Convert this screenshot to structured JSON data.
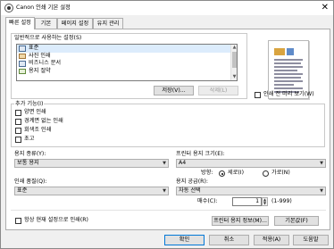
{
  "window": {
    "title": "Canon 인쇄 기본 설정",
    "close_glyph": "✕"
  },
  "tabs": [
    {
      "label": "빠른 설정",
      "active": true
    },
    {
      "label": "기본"
    },
    {
      "label": "페이지 설정"
    },
    {
      "label": "유지 관리"
    }
  ],
  "presets": {
    "label": "일반적으로 사용하는 설정(S)",
    "items": [
      {
        "label": "표준",
        "selected": true
      },
      {
        "label": "사진 인쇄"
      },
      {
        "label": "비즈니스 문서"
      },
      {
        "label": "용지 절약"
      }
    ],
    "save_button": "저장(V)...",
    "delete_button": "삭제(L)"
  },
  "preview": {
    "checkbox_label": "인쇄 전 미리 보기(W)"
  },
  "additional": {
    "label": "추가 기능(I)",
    "options": [
      {
        "label": "양면 인쇄"
      },
      {
        "label": "경계면 없는 인쇄"
      },
      {
        "label": "회색조 인쇄"
      },
      {
        "label": "초고"
      }
    ]
  },
  "media_type": {
    "label": "용지 종류(Y):",
    "value": "보통 용지"
  },
  "printer_paper_size": {
    "label": "프린터 용지 크기(E):",
    "value": "A4"
  },
  "orientation": {
    "label": "방향:",
    "portrait": "세로(I)",
    "landscape": "가로(N)",
    "selected": "portrait"
  },
  "print_quality": {
    "label": "인쇄 품질(Q):",
    "value": "표준"
  },
  "paper_source": {
    "label": "용지 공급(R):",
    "value": "자동 선택"
  },
  "copies": {
    "label": "매수(C):",
    "value": "1",
    "range": "(1-999)"
  },
  "always_print_checkbox": "항상 현재 설정으로 인쇄(R)",
  "printer_paper_info_button": "프린터 용지 정보(M)...",
  "defaults_button": "기본값(F)",
  "footer": {
    "ok": "확인",
    "cancel": "취소",
    "apply": "적용(A)",
    "help": "도움말"
  },
  "colors": {
    "selected_row": "#dcecfc",
    "default_button_border": "#0078d7"
  }
}
